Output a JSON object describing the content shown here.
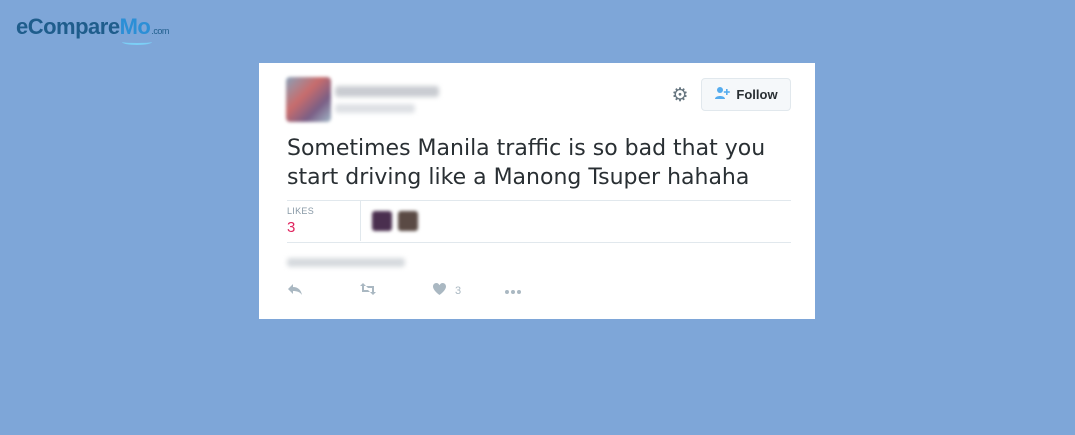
{
  "brand": {
    "logo_part1": "eCompare",
    "logo_part2": "Mo",
    "logo_part3": ".com"
  },
  "tweet": {
    "follow_label": "Follow",
    "text": "Sometimes Manila traffic is so bad that you start driving like a Manong Tsuper hahaha",
    "likes_label": "LIKES",
    "likes_count": "3",
    "action_like_count": "3"
  },
  "colors": {
    "background": "#7ea6d8",
    "card": "#ffffff",
    "likes_count": "#e0245e",
    "follow_icon": "#55acee",
    "action_icons": "#aab8c2"
  },
  "icons": {
    "settings": "gear-icon",
    "follow": "person-add-icon",
    "reply": "reply-icon",
    "retweet": "retweet-icon",
    "like": "heart-icon",
    "more": "more-icon"
  }
}
